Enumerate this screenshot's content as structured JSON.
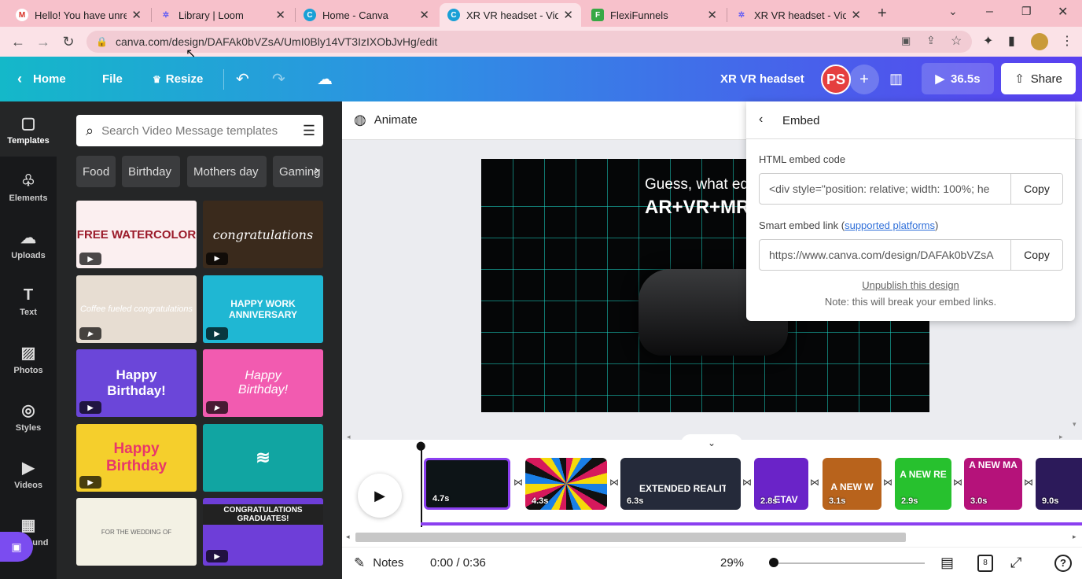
{
  "browser": {
    "tabs": [
      {
        "title": "Hello! You have unrea",
        "fav": "M",
        "color": "#d93025"
      },
      {
        "title": "Library | Loom",
        "fav": "✲",
        "color": "#625df5"
      },
      {
        "title": "Home - Canva",
        "fav": "C",
        "color": "#19a0d6"
      },
      {
        "title": "XR VR headset - Vide",
        "fav": "C",
        "color": "#19a0d6"
      },
      {
        "title": "FlexiFunnels",
        "fav": "F",
        "color": "#37a845"
      },
      {
        "title": "XR VR headset - Vide",
        "fav": "✲",
        "color": "#625df5"
      }
    ],
    "url": "canva.com/design/DAFAk0bVZsA/UmI0Bly14VT3IzIXObJvHg/edit"
  },
  "header": {
    "home": "Home",
    "file": "File",
    "resize": "Resize",
    "design_title": "XR VR headset",
    "avatar_initials": "PS",
    "play_duration": "36.5s",
    "share": "Share"
  },
  "rail": [
    {
      "label": "Templates",
      "icon": "▢"
    },
    {
      "label": "Elements",
      "icon": "♧"
    },
    {
      "label": "Uploads",
      "icon": "☁"
    },
    {
      "label": "Text",
      "icon": "T"
    },
    {
      "label": "Photos",
      "icon": "▨"
    },
    {
      "label": "Styles",
      "icon": "◎"
    },
    {
      "label": "Videos",
      "icon": "▶"
    },
    {
      "label": "ound",
      "icon": "▦"
    }
  ],
  "panel": {
    "search_placeholder": "Search Video Message templates",
    "chips": [
      "Food",
      "Birthday",
      "Mothers day",
      "Gaming"
    ],
    "thumbs": [
      {
        "text": "FREE WATERCOLOR",
        "bg": "#fbeff0",
        "fg": "#9b1b2a"
      },
      {
        "text": "congratulations",
        "bg": "#3a2a1c",
        "fg": "#ffffff"
      },
      {
        "text": "Coffee fueled congratulations",
        "bg": "#e7ddd2",
        "fg": "#ffffff"
      },
      {
        "text": "HAPPY WORK ANNIVERSARY",
        "bg": "#1fb7d3",
        "fg": "#ffffff"
      },
      {
        "text": "Happy Birthday!",
        "bg": "#6b46d9",
        "fg": "#ffffff"
      },
      {
        "text": "Happy Birthday!",
        "bg": "#f25bb0",
        "fg": "#ffffff"
      },
      {
        "text": "Happy Birthday",
        "bg": "#f5cf2c",
        "fg": "#e8376a"
      },
      {
        "text": "",
        "bg": "#11a5a2",
        "fg": "#ffffff"
      },
      {
        "text": "FOR THE WEDDING OF",
        "bg": "#f3f1e4",
        "fg": "#666666"
      },
      {
        "text": "CONGRATULATIONS GRADUATES!",
        "bg": "#6e3ed8",
        "fg": "#ffffff"
      }
    ]
  },
  "editor": {
    "animate": "Animate",
    "slide_text_1": "Guess, what eq",
    "slide_text_2": "AR+VR+MR"
  },
  "embed": {
    "title": "Embed",
    "html_label": "HTML embed code",
    "html_value": "<div style=\"position: relative; width: 100%; he",
    "copy": "Copy",
    "smart_label_pre": "Smart embed link (",
    "smart_link": "supported platforms",
    "smart_label_post": ")",
    "smart_value": "https://www.canva.com/design/DAFAk0bVZsA",
    "unpublish": "Unpublish this design",
    "note": "Note: this will break your embed links."
  },
  "timeline": {
    "clips": [
      {
        "dur": "4.7s",
        "label": "",
        "bg": "#0d1417"
      },
      {
        "dur": "4.3s",
        "label": "",
        "bg": "#d6195c"
      },
      {
        "dur": "6.3s",
        "label": "EXTENDED REALITY",
        "bg": "#252a3a"
      },
      {
        "dur": "2.8s",
        "label": "ETAV",
        "bg": "#6a23c8"
      },
      {
        "dur": "3.1s",
        "label": "A NEW W",
        "bg": "#b8631c"
      },
      {
        "dur": "2.9s",
        "label": "A NEW RE",
        "bg": "#27c12e"
      },
      {
        "dur": "3.0s",
        "label": "A NEW MA",
        "bg": "#b5127a"
      },
      {
        "dur": "9.0s",
        "label": "",
        "bg": "#2c1a5a"
      }
    ]
  },
  "footer": {
    "notes": "Notes",
    "time": "0:00 / 0:36",
    "zoom": "29%",
    "pages": "8"
  }
}
